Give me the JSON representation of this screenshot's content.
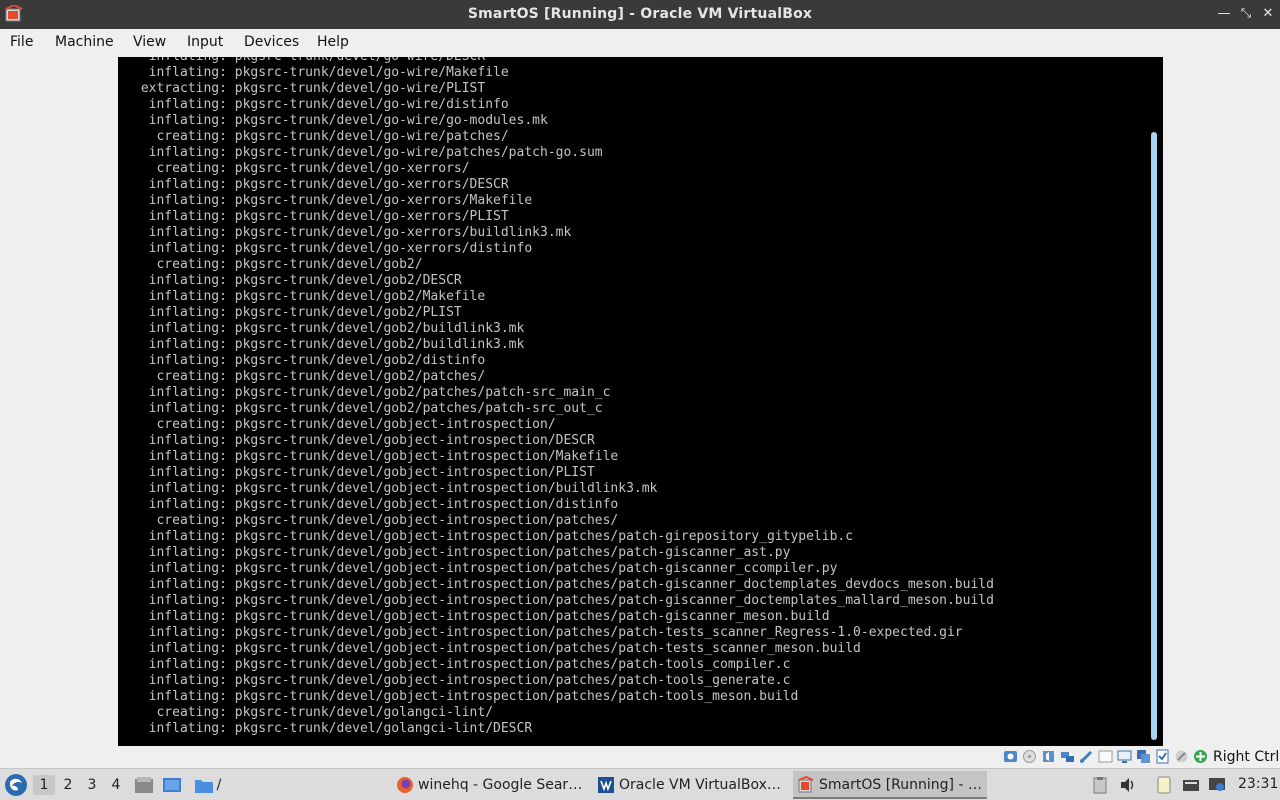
{
  "window": {
    "title": "SmartOS [Running] - Oracle VM VirtualBox"
  },
  "menu": [
    "File",
    "Machine",
    "View",
    "Input",
    "Devices",
    "Help"
  ],
  "terminal": {
    "lines": [
      "  inflating: pkgsrc-trunk/devel/go-wire/DESCR",
      "  inflating: pkgsrc-trunk/devel/go-wire/Makefile",
      " extracting: pkgsrc-trunk/devel/go-wire/PLIST",
      "  inflating: pkgsrc-trunk/devel/go-wire/distinfo",
      "  inflating: pkgsrc-trunk/devel/go-wire/go-modules.mk",
      "   creating: pkgsrc-trunk/devel/go-wire/patches/",
      "  inflating: pkgsrc-trunk/devel/go-wire/patches/patch-go.sum",
      "   creating: pkgsrc-trunk/devel/go-xerrors/",
      "  inflating: pkgsrc-trunk/devel/go-xerrors/DESCR",
      "  inflating: pkgsrc-trunk/devel/go-xerrors/Makefile",
      "  inflating: pkgsrc-trunk/devel/go-xerrors/PLIST",
      "  inflating: pkgsrc-trunk/devel/go-xerrors/buildlink3.mk",
      "  inflating: pkgsrc-trunk/devel/go-xerrors/distinfo",
      "   creating: pkgsrc-trunk/devel/gob2/",
      "  inflating: pkgsrc-trunk/devel/gob2/DESCR",
      "  inflating: pkgsrc-trunk/devel/gob2/Makefile",
      "  inflating: pkgsrc-trunk/devel/gob2/PLIST",
      "  inflating: pkgsrc-trunk/devel/gob2/buildlink3.mk",
      "  inflating: pkgsrc-trunk/devel/gob2/buildlink3.mk",
      "  inflating: pkgsrc-trunk/devel/gob2/distinfo",
      "   creating: pkgsrc-trunk/devel/gob2/patches/",
      "  inflating: pkgsrc-trunk/devel/gob2/patches/patch-src_main_c",
      "  inflating: pkgsrc-trunk/devel/gob2/patches/patch-src_out_c",
      "   creating: pkgsrc-trunk/devel/gobject-introspection/",
      "  inflating: pkgsrc-trunk/devel/gobject-introspection/DESCR",
      "  inflating: pkgsrc-trunk/devel/gobject-introspection/Makefile",
      "  inflating: pkgsrc-trunk/devel/gobject-introspection/PLIST",
      "  inflating: pkgsrc-trunk/devel/gobject-introspection/buildlink3.mk",
      "  inflating: pkgsrc-trunk/devel/gobject-introspection/distinfo",
      "   creating: pkgsrc-trunk/devel/gobject-introspection/patches/",
      "  inflating: pkgsrc-trunk/devel/gobject-introspection/patches/patch-girepository_gitypelib.c",
      "  inflating: pkgsrc-trunk/devel/gobject-introspection/patches/patch-giscanner_ast.py",
      "  inflating: pkgsrc-trunk/devel/gobject-introspection/patches/patch-giscanner_ccompiler.py",
      "  inflating: pkgsrc-trunk/devel/gobject-introspection/patches/patch-giscanner_doctemplates_devdocs_meson.build",
      "  inflating: pkgsrc-trunk/devel/gobject-introspection/patches/patch-giscanner_doctemplates_mallard_meson.build",
      "  inflating: pkgsrc-trunk/devel/gobject-introspection/patches/patch-giscanner_meson.build",
      "  inflating: pkgsrc-trunk/devel/gobject-introspection/patches/patch-tests_scanner_Regress-1.0-expected.gir",
      "  inflating: pkgsrc-trunk/devel/gobject-introspection/patches/patch-tests_scanner_meson.build",
      "  inflating: pkgsrc-trunk/devel/gobject-introspection/patches/patch-tools_compiler.c",
      "  inflating: pkgsrc-trunk/devel/gobject-introspection/patches/patch-tools_generate.c",
      "  inflating: pkgsrc-trunk/devel/gobject-introspection/patches/patch-tools_meson.build",
      "   creating: pkgsrc-trunk/devel/golangci-lint/",
      "  inflating: pkgsrc-trunk/devel/golangci-lint/DESCR"
    ]
  },
  "statusbar": {
    "host_key": "Right Ctrl",
    "icons": [
      "hard-disk-icon",
      "optical-drive-icon",
      "audio-icon",
      "network-icon",
      "usb-icon",
      "shared-folders-icon",
      "display-icon",
      "recording-icon",
      "cpu-icon",
      "mouse-integration-icon",
      "keyboard-icon"
    ]
  },
  "taskbar": {
    "desktops": [
      "1",
      "2",
      "3",
      "4"
    ],
    "path_label": "/",
    "tasks": [
      {
        "label": "winehq - Google Sear…",
        "icon": "firefox-icon"
      },
      {
        "label": "Oracle VM VirtualBox…",
        "icon": "virtualbox-manager-icon"
      },
      {
        "label": "SmartOS [Running] - …",
        "icon": "virtualbox-vm-icon"
      }
    ],
    "clock": "23:31"
  }
}
